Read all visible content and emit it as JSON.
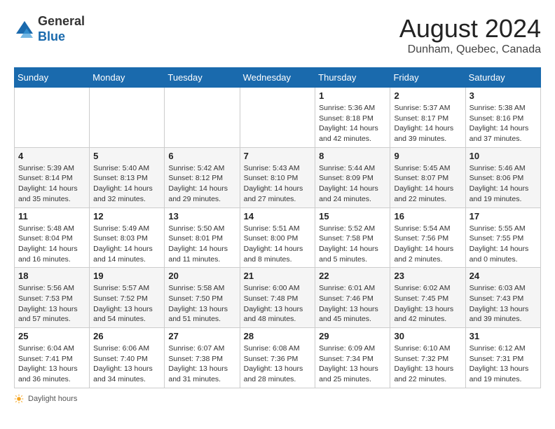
{
  "header": {
    "logo_line1": "General",
    "logo_line2": "Blue",
    "month_year": "August 2024",
    "location": "Dunham, Quebec, Canada"
  },
  "days_of_week": [
    "Sunday",
    "Monday",
    "Tuesday",
    "Wednesday",
    "Thursday",
    "Friday",
    "Saturday"
  ],
  "weeks": [
    [
      {
        "day": "",
        "info": ""
      },
      {
        "day": "",
        "info": ""
      },
      {
        "day": "",
        "info": ""
      },
      {
        "day": "",
        "info": ""
      },
      {
        "day": "1",
        "info": "Sunrise: 5:36 AM\nSunset: 8:18 PM\nDaylight: 14 hours\nand 42 minutes."
      },
      {
        "day": "2",
        "info": "Sunrise: 5:37 AM\nSunset: 8:17 PM\nDaylight: 14 hours\nand 39 minutes."
      },
      {
        "day": "3",
        "info": "Sunrise: 5:38 AM\nSunset: 8:16 PM\nDaylight: 14 hours\nand 37 minutes."
      }
    ],
    [
      {
        "day": "4",
        "info": "Sunrise: 5:39 AM\nSunset: 8:14 PM\nDaylight: 14 hours\nand 35 minutes."
      },
      {
        "day": "5",
        "info": "Sunrise: 5:40 AM\nSunset: 8:13 PM\nDaylight: 14 hours\nand 32 minutes."
      },
      {
        "day": "6",
        "info": "Sunrise: 5:42 AM\nSunset: 8:12 PM\nDaylight: 14 hours\nand 29 minutes."
      },
      {
        "day": "7",
        "info": "Sunrise: 5:43 AM\nSunset: 8:10 PM\nDaylight: 14 hours\nand 27 minutes."
      },
      {
        "day": "8",
        "info": "Sunrise: 5:44 AM\nSunset: 8:09 PM\nDaylight: 14 hours\nand 24 minutes."
      },
      {
        "day": "9",
        "info": "Sunrise: 5:45 AM\nSunset: 8:07 PM\nDaylight: 14 hours\nand 22 minutes."
      },
      {
        "day": "10",
        "info": "Sunrise: 5:46 AM\nSunset: 8:06 PM\nDaylight: 14 hours\nand 19 minutes."
      }
    ],
    [
      {
        "day": "11",
        "info": "Sunrise: 5:48 AM\nSunset: 8:04 PM\nDaylight: 14 hours\nand 16 minutes."
      },
      {
        "day": "12",
        "info": "Sunrise: 5:49 AM\nSunset: 8:03 PM\nDaylight: 14 hours\nand 14 minutes."
      },
      {
        "day": "13",
        "info": "Sunrise: 5:50 AM\nSunset: 8:01 PM\nDaylight: 14 hours\nand 11 minutes."
      },
      {
        "day": "14",
        "info": "Sunrise: 5:51 AM\nSunset: 8:00 PM\nDaylight: 14 hours\nand 8 minutes."
      },
      {
        "day": "15",
        "info": "Sunrise: 5:52 AM\nSunset: 7:58 PM\nDaylight: 14 hours\nand 5 minutes."
      },
      {
        "day": "16",
        "info": "Sunrise: 5:54 AM\nSunset: 7:56 PM\nDaylight: 14 hours\nand 2 minutes."
      },
      {
        "day": "17",
        "info": "Sunrise: 5:55 AM\nSunset: 7:55 PM\nDaylight: 14 hours\nand 0 minutes."
      }
    ],
    [
      {
        "day": "18",
        "info": "Sunrise: 5:56 AM\nSunset: 7:53 PM\nDaylight: 13 hours\nand 57 minutes."
      },
      {
        "day": "19",
        "info": "Sunrise: 5:57 AM\nSunset: 7:52 PM\nDaylight: 13 hours\nand 54 minutes."
      },
      {
        "day": "20",
        "info": "Sunrise: 5:58 AM\nSunset: 7:50 PM\nDaylight: 13 hours\nand 51 minutes."
      },
      {
        "day": "21",
        "info": "Sunrise: 6:00 AM\nSunset: 7:48 PM\nDaylight: 13 hours\nand 48 minutes."
      },
      {
        "day": "22",
        "info": "Sunrise: 6:01 AM\nSunset: 7:46 PM\nDaylight: 13 hours\nand 45 minutes."
      },
      {
        "day": "23",
        "info": "Sunrise: 6:02 AM\nSunset: 7:45 PM\nDaylight: 13 hours\nand 42 minutes."
      },
      {
        "day": "24",
        "info": "Sunrise: 6:03 AM\nSunset: 7:43 PM\nDaylight: 13 hours\nand 39 minutes."
      }
    ],
    [
      {
        "day": "25",
        "info": "Sunrise: 6:04 AM\nSunset: 7:41 PM\nDaylight: 13 hours\nand 36 minutes."
      },
      {
        "day": "26",
        "info": "Sunrise: 6:06 AM\nSunset: 7:40 PM\nDaylight: 13 hours\nand 34 minutes."
      },
      {
        "day": "27",
        "info": "Sunrise: 6:07 AM\nSunset: 7:38 PM\nDaylight: 13 hours\nand 31 minutes."
      },
      {
        "day": "28",
        "info": "Sunrise: 6:08 AM\nSunset: 7:36 PM\nDaylight: 13 hours\nand 28 minutes."
      },
      {
        "day": "29",
        "info": "Sunrise: 6:09 AM\nSunset: 7:34 PM\nDaylight: 13 hours\nand 25 minutes."
      },
      {
        "day": "30",
        "info": "Sunrise: 6:10 AM\nSunset: 7:32 PM\nDaylight: 13 hours\nand 22 minutes."
      },
      {
        "day": "31",
        "info": "Sunrise: 6:12 AM\nSunset: 7:31 PM\nDaylight: 13 hours\nand 19 minutes."
      }
    ]
  ],
  "footer": {
    "daylight_label": "Daylight hours"
  }
}
